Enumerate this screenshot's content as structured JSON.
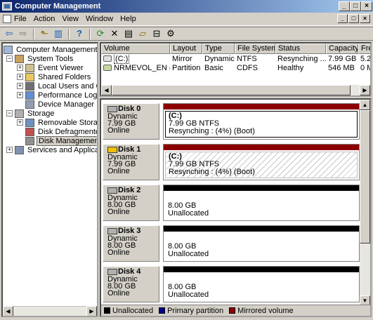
{
  "window": {
    "title": "Computer Management",
    "minimize": "_",
    "maximize": "□",
    "close": "×"
  },
  "menu": [
    {
      "label": "File",
      "key": "F"
    },
    {
      "label": "Action",
      "key": "A"
    },
    {
      "label": "View",
      "key": "V"
    },
    {
      "label": "Window",
      "key": "W"
    },
    {
      "label": "Help",
      "key": "H"
    }
  ],
  "toolbar": {
    "back": "⇦",
    "forward": "⇨",
    "up": "⬑",
    "showhide": "▥",
    "help": "?",
    "refresh": "⟳",
    "delete": "✕",
    "properties": "▤",
    "open": "▱",
    "export": "⊟",
    "settings": "⚙"
  },
  "tree": {
    "items": [
      {
        "label": "Computer Management (Local)",
        "icon": "computer-icon"
      },
      {
        "label": "System Tools",
        "icon": "tools-icon",
        "expander": "−"
      },
      {
        "label": "Event Viewer",
        "icon": "event-viewer-icon",
        "expander": "+"
      },
      {
        "label": "Shared Folders",
        "icon": "folder-icon",
        "expander": "+"
      },
      {
        "label": "Local Users and Groups",
        "icon": "users-icon",
        "expander": "+"
      },
      {
        "label": "Performance Logs and Alerts",
        "icon": "performance-icon",
        "expander": "+"
      },
      {
        "label": "Device Manager",
        "icon": "device-manager-icon"
      },
      {
        "label": "Storage",
        "icon": "storage-icon",
        "expander": "−"
      },
      {
        "label": "Removable Storage",
        "icon": "removable-storage-icon",
        "expander": "+"
      },
      {
        "label": "Disk Defragmenter",
        "icon": "defrag-icon"
      },
      {
        "label": "Disk Management",
        "icon": "disk-management-icon"
      },
      {
        "label": "Services and Applications",
        "icon": "services-icon",
        "expander": "+"
      }
    ]
  },
  "list": {
    "columns": [
      "Volume",
      "Layout",
      "Type",
      "File System",
      "Status",
      "Capacity",
      "Fre"
    ],
    "rows": [
      [
        "(C:)",
        "Mirror",
        "Dynamic",
        "NTFS",
        "Resynching ...",
        "7.99 GB",
        "5.2"
      ],
      [
        "NRMEVOL_EN (D:)",
        "Partition",
        "Basic",
        "CDFS",
        "Healthy",
        "546 MB",
        "0 M"
      ]
    ]
  },
  "disks": [
    {
      "name": "Disk 0",
      "type": "Dynamic",
      "size": "7.99 GB",
      "state": "Online",
      "vol_name": "(C:)",
      "vol_size": "7.99 GB NTFS",
      "vol_status": "Resynching : (4%) (Boot)",
      "bar_color": "#8b0000"
    },
    {
      "name": "Disk 1",
      "type": "Dynamic",
      "size": "7.99 GB",
      "state": "Online",
      "vol_name": "(C:)",
      "vol_size": "7.99 GB NTFS",
      "vol_status": "Resynching : (4%) (Boot)",
      "bar_color": "#8b0000"
    },
    {
      "name": "Disk 2",
      "type": "Dynamic",
      "size": "8.00 GB",
      "state": "Online",
      "vol_name": "",
      "vol_size": "8.00 GB",
      "vol_status": "Unallocated",
      "bar_color": "#000000"
    },
    {
      "name": "Disk 3",
      "type": "Dynamic",
      "size": "8.00 GB",
      "state": "Online",
      "vol_name": "",
      "vol_size": "8.00 GB",
      "vol_status": "Unallocated",
      "bar_color": "#000000"
    },
    {
      "name": "Disk 4",
      "type": "Dynamic",
      "size": "8.00 GB",
      "state": "Online",
      "vol_name": "",
      "vol_size": "8.00 GB",
      "vol_status": "Unallocated",
      "bar_color": "#000000"
    }
  ],
  "legend": [
    {
      "label": "Unallocated",
      "color": "#000000"
    },
    {
      "label": "Primary partition",
      "color": "#00008b"
    },
    {
      "label": "Mirrored volume",
      "color": "#8b0000"
    }
  ]
}
